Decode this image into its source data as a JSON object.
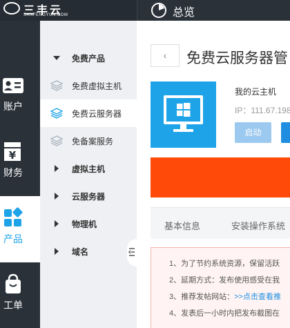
{
  "brand": {
    "name": "三丰云",
    "domain": "SANFENGYUN.COM"
  },
  "header": {
    "title": "总览"
  },
  "rail": [
    {
      "label": "账户",
      "icon": "id-card-icon"
    },
    {
      "label": "财务",
      "icon": "yen-icon"
    },
    {
      "label": "产品",
      "icon": "apps-icon",
      "active": true
    },
    {
      "label": "工单",
      "icon": "bag-icon"
    }
  ],
  "menu": {
    "free_products": "免费产品",
    "free_vhost": "免费虚拟主机",
    "free_cloud_server": "免费云服务器",
    "free_filing_service": "免备案服务",
    "virtual_host": "虚拟主机",
    "cloud_server": "云服务器",
    "physical_machine": "物理机",
    "domain": "域名",
    "selected": "免费云服务器"
  },
  "main": {
    "back_glyph": "‹",
    "page_title": "免费云服务器管",
    "server_name": "我的云主机",
    "server_ip": "IP：111.67.198",
    "start_button": "启动",
    "tabs": [
      "基本信息",
      "安装操作系统"
    ],
    "notices": [
      "1、为了节约系统资源，保留活跃",
      "2、延期方式：发布使用感受在我",
      "3、推荐发帖网站：",
      "4、发表后一小时内把发布截图在"
    ],
    "notice_link": ">>点击查看推"
  },
  "colors": {
    "sidebar_bg": "#2a3139",
    "accent_blue": "#1fa3e8",
    "banner_orange": "#ff4a0a"
  }
}
